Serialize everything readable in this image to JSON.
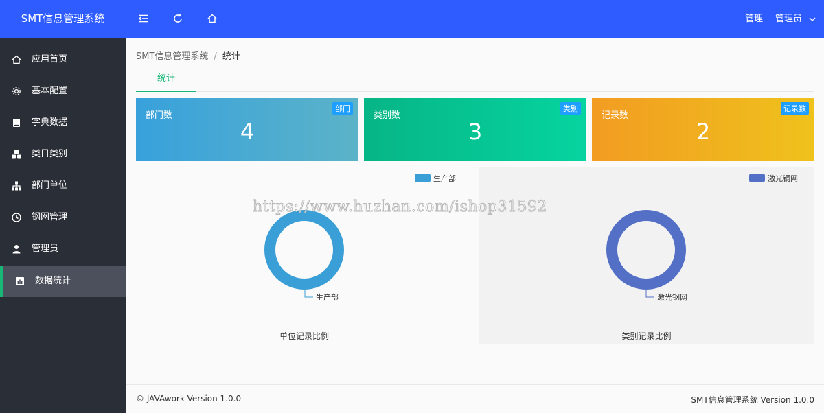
{
  "app": {
    "title": "SMT信息管理系统"
  },
  "header": {
    "manage_label": "管理",
    "user_label": "管理员"
  },
  "sidebar": {
    "items": [
      {
        "label": "应用首页",
        "icon": "home-icon"
      },
      {
        "label": "基本配置",
        "icon": "gear-icon"
      },
      {
        "label": "字典数据",
        "icon": "book-icon"
      },
      {
        "label": "类目类别",
        "icon": "cubes-icon"
      },
      {
        "label": "部门单位",
        "icon": "org-chart-icon"
      },
      {
        "label": "钢网管理",
        "icon": "clock-icon"
      },
      {
        "label": "管理员",
        "icon": "user-icon"
      },
      {
        "label": "数据统计",
        "icon": "bar-chart-icon",
        "active": true
      }
    ]
  },
  "breadcrumb": {
    "root": "SMT信息管理系统",
    "separator": "/",
    "current": "统计"
  },
  "tabs": [
    {
      "label": "统计",
      "active": true
    }
  ],
  "stats": [
    {
      "title": "部门数",
      "badge": "部门",
      "value": "4"
    },
    {
      "title": "类别数",
      "badge": "类别",
      "value": "3"
    },
    {
      "title": "记录数",
      "badge": "记录数",
      "value": "2"
    }
  ],
  "chart_data": [
    {
      "type": "pie",
      "title": "单位记录比例",
      "categories": [
        "生产部"
      ],
      "values": [
        1
      ],
      "colors": [
        "#3a9fd6"
      ],
      "legend": "top-right"
    },
    {
      "type": "pie",
      "title": "类别记录比例",
      "categories": [
        "激光钢网"
      ],
      "values": [
        1
      ],
      "colors": [
        "#5470c6"
      ],
      "legend": "top-right"
    }
  ],
  "watermark": "https://www.huzhan.com/ishop31592",
  "footer": {
    "left": "© JAVAwork Version 1.0.0",
    "right": "SMT信息管理系统 Version 1.0.0"
  },
  "colors": {
    "header": "#2f5cff",
    "sidebar": "#2a2e36",
    "accent": "#16b777",
    "badge": "#1e9fff"
  }
}
